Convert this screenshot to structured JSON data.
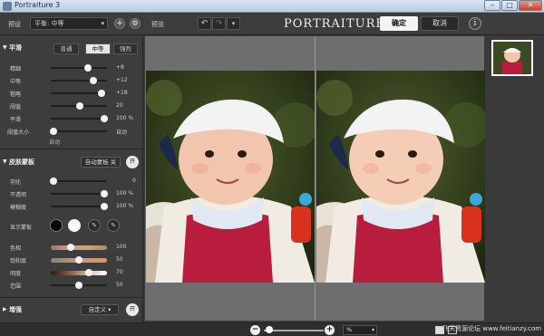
{
  "window": {
    "title": "Portraiture 3",
    "minimize": "–",
    "maximize": "□",
    "close": "✕"
  },
  "toolbar": {
    "preset_label": "预设",
    "preset_value": "平衡: 中等",
    "preset_arrow": "▾",
    "add_label": "+",
    "gear_label": "⚙",
    "preview_label": "预览",
    "undo": "↶",
    "redo": "↷",
    "history_arrow": "▾",
    "brand": "PORTRAITURE 3ai",
    "ok": "确定",
    "cancel": "取消",
    "info": "i"
  },
  "smoothing": {
    "title": "平滑",
    "arrow": "▼",
    "modes": [
      "普通",
      "中等",
      "强烈"
    ],
    "selected_mode": "中等",
    "sliders": [
      {
        "label": "精细",
        "value": "+8",
        "level": 0.65
      },
      {
        "label": "中等",
        "value": "+12",
        "level": 0.72
      },
      {
        "label": "粗略",
        "value": "+18",
        "level": 0.88
      },
      {
        "label": "阈值",
        "value": "20",
        "level": 0.45
      },
      {
        "label": "平滑",
        "value": "100 %",
        "level": 1.0
      },
      {
        "label": "阈值大小",
        "value": "自动",
        "level": 0.0
      }
    ],
    "auto_note": "自动"
  },
  "skin_mask": {
    "title": "皮肤蒙板",
    "arrow": "▼",
    "auto_button": "自动蒙板 关",
    "toggle": "开",
    "sliders": [
      {
        "label": "羽化",
        "value": "0",
        "level": 0.0
      },
      {
        "label": "不透明",
        "value": "100 %",
        "level": 1.0
      },
      {
        "label": "模糊度",
        "value": "100 %",
        "level": 1.0
      }
    ],
    "show_mask_label": "显示蒙板",
    "color_sliders": [
      {
        "label": "色相",
        "value": "100",
        "level": 0.35
      },
      {
        "label": "饱和度",
        "value": "50",
        "level": 0.5
      },
      {
        "label": "明度",
        "value": "70",
        "level": 0.7
      },
      {
        "label": "范围",
        "value": "50",
        "level": 0.5
      }
    ],
    "eyedropper": "✎",
    "eyedropper_minus": "✎"
  },
  "enhance": {
    "title": "增强",
    "arrow": "▶",
    "custom": "自定义",
    "custom_arrow": "▾",
    "toggle": "开"
  },
  "bottom": {
    "minus": "−",
    "plus": "+",
    "zoom": "%",
    "zoom_arrow": "▾",
    "watermark": "飞天资源论坛 www.feitianzy.com"
  },
  "colors": {
    "accent": "#f4f4f4",
    "panel": "#3d3d3d",
    "canvas": "#6e6e6e"
  }
}
